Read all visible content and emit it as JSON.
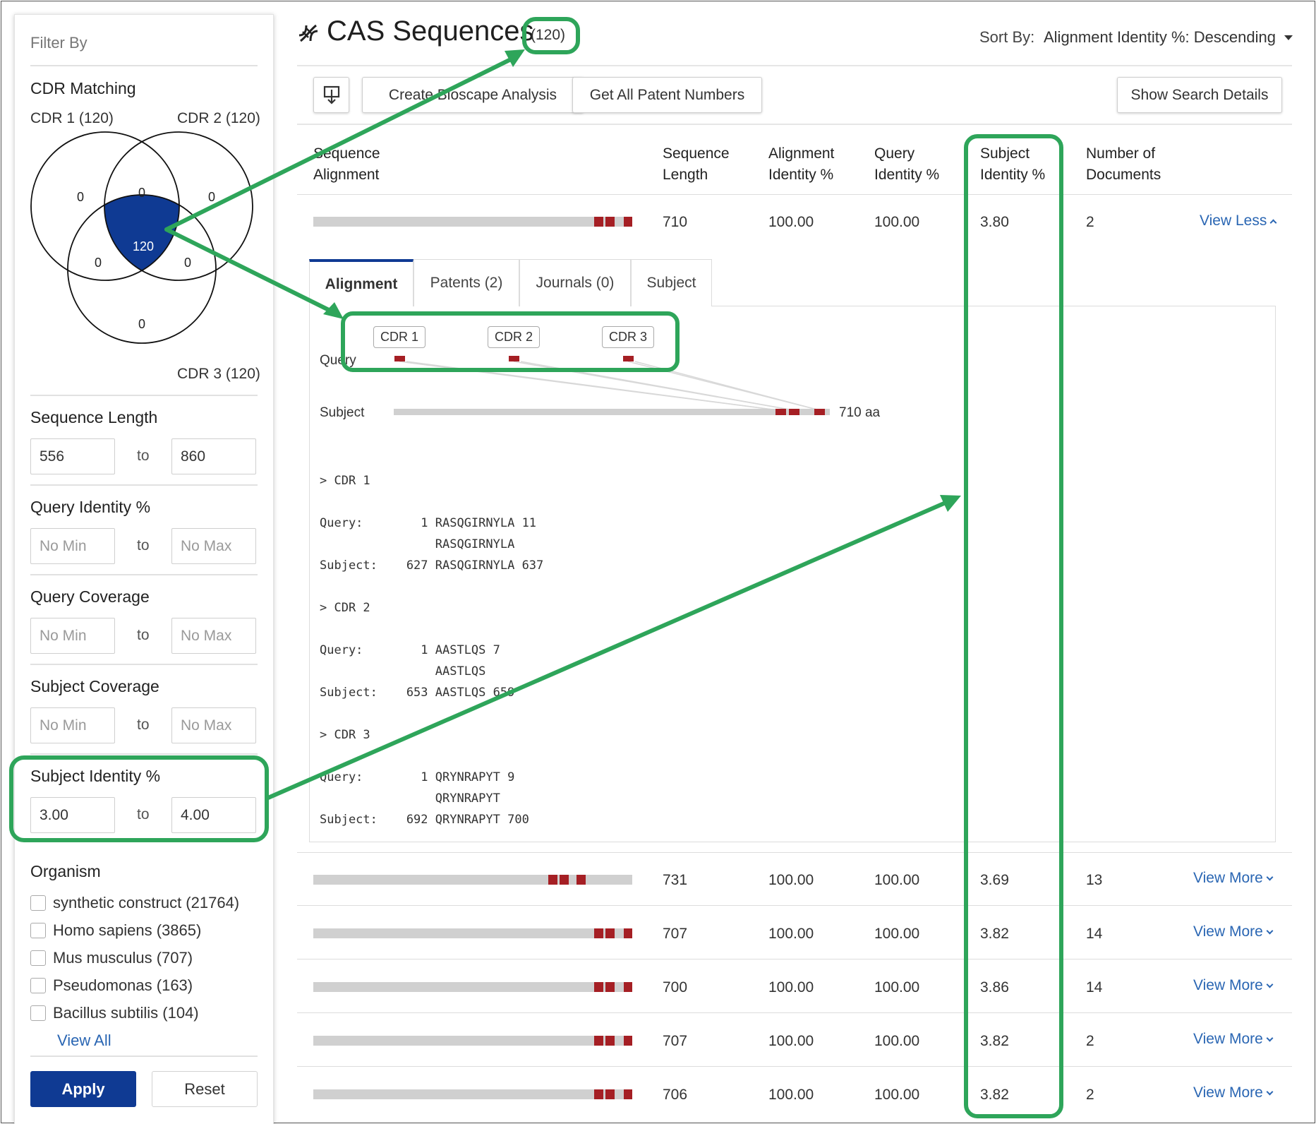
{
  "sidebar": {
    "filter_by": "Filter By",
    "cdr_matching": {
      "title": "CDR Matching",
      "cdr1_label": "CDR 1 (120)",
      "cdr2_label": "CDR 2 (120)",
      "cdr3_label": "CDR 3 (120)",
      "regions": {
        "only1": "0",
        "top12": "0",
        "only2": "0",
        "center": "120",
        "left13": "0",
        "right23": "0",
        "only3": "0"
      }
    },
    "sequence_length": {
      "title": "Sequence Length",
      "min": "556",
      "to": "to",
      "max": "860"
    },
    "query_identity": {
      "title": "Query Identity %",
      "min_placeholder": "No Min",
      "to": "to",
      "max_placeholder": "No Max"
    },
    "query_coverage": {
      "title": "Query Coverage",
      "min_placeholder": "No Min",
      "to": "to",
      "max_placeholder": "No Max"
    },
    "subject_coverage": {
      "title": "Subject Coverage",
      "min_placeholder": "No Min",
      "to": "to",
      "max_placeholder": "No Max"
    },
    "subject_identity": {
      "title": "Subject Identity %",
      "min": "3.00",
      "to": "to",
      "max": "4.00"
    },
    "organism": {
      "title": "Organism",
      "items": [
        "synthetic construct (21764)",
        "Homo sapiens (3865)",
        "Mus musculus (707)",
        "Pseudomonas (163)",
        "Bacillus subtilis (104)"
      ],
      "view_all": "View All"
    },
    "apply": "Apply",
    "reset": "Reset"
  },
  "header": {
    "title": "CAS Sequences",
    "count": "(120)",
    "sort_label": "Sort By:",
    "sort_value": "Alignment Identity %: Descending",
    "icon": "dna-icon"
  },
  "toolbar": {
    "download_icon": "download-icon",
    "create_analysis": "Create Bioscape Analysis",
    "get_patents": "Get All Patent Numbers",
    "show_search": "Show Search Details"
  },
  "table": {
    "headers": {
      "alignment": [
        "Sequence",
        "Alignment"
      ],
      "length": [
        "Sequence",
        "Length"
      ],
      "align_id": [
        "Alignment",
        "Identity %"
      ],
      "query_id": [
        "Query",
        "Identity %"
      ],
      "subject_id": [
        "Subject",
        "Identity %"
      ],
      "docs": [
        "Number of",
        "Documents"
      ]
    },
    "rows": [
      {
        "length": "710",
        "align_id": "100.00",
        "query_id": "100.00",
        "subject_id": "3.80",
        "docs": "2",
        "link": "View Less"
      },
      {
        "length": "731",
        "align_id": "100.00",
        "query_id": "100.00",
        "subject_id": "3.69",
        "docs": "13",
        "link": "View More"
      },
      {
        "length": "707",
        "align_id": "100.00",
        "query_id": "100.00",
        "subject_id": "3.82",
        "docs": "14",
        "link": "View More"
      },
      {
        "length": "700",
        "align_id": "100.00",
        "query_id": "100.00",
        "subject_id": "3.86",
        "docs": "14",
        "link": "View More"
      },
      {
        "length": "707",
        "align_id": "100.00",
        "query_id": "100.00",
        "subject_id": "3.82",
        "docs": "2",
        "link": "View More"
      },
      {
        "length": "706",
        "align_id": "100.00",
        "query_id": "100.00",
        "subject_id": "3.82",
        "docs": "2",
        "link": "View More"
      }
    ]
  },
  "detail": {
    "tabs": [
      "Alignment",
      "Patents (2)",
      "Journals (0)",
      "Subject"
    ],
    "cdr_pills": [
      "CDR 1",
      "CDR 2",
      "CDR 3"
    ],
    "query_label": "Query",
    "subject_label": "Subject",
    "subject_length": "710 aa",
    "blocks": [
      {
        "header": "> CDR 1",
        "query": "Query:        1 RASQGIRNYLA 11",
        "match": "                RASQGIRNYLA",
        "subject": "Subject:    627 RASQGIRNYLA 637"
      },
      {
        "header": "> CDR 2",
        "query": "Query:        1 AASTLQS 7",
        "match": "                AASTLQS",
        "subject": "Subject:    653 AASTLQS 659"
      },
      {
        "header": "> CDR 3",
        "query": "Query:        1 QRYNRAPYT 9",
        "match": "                QRYNRAPYT",
        "subject": "Subject:    692 QRYNRAPYT 700"
      }
    ]
  },
  "colors": {
    "accent_green": "#2ea55a",
    "primary_blue": "#0f3a93",
    "link_blue": "#2a66b3",
    "mark_red": "#a51f24",
    "bar_gray": "#d0d0d0"
  }
}
